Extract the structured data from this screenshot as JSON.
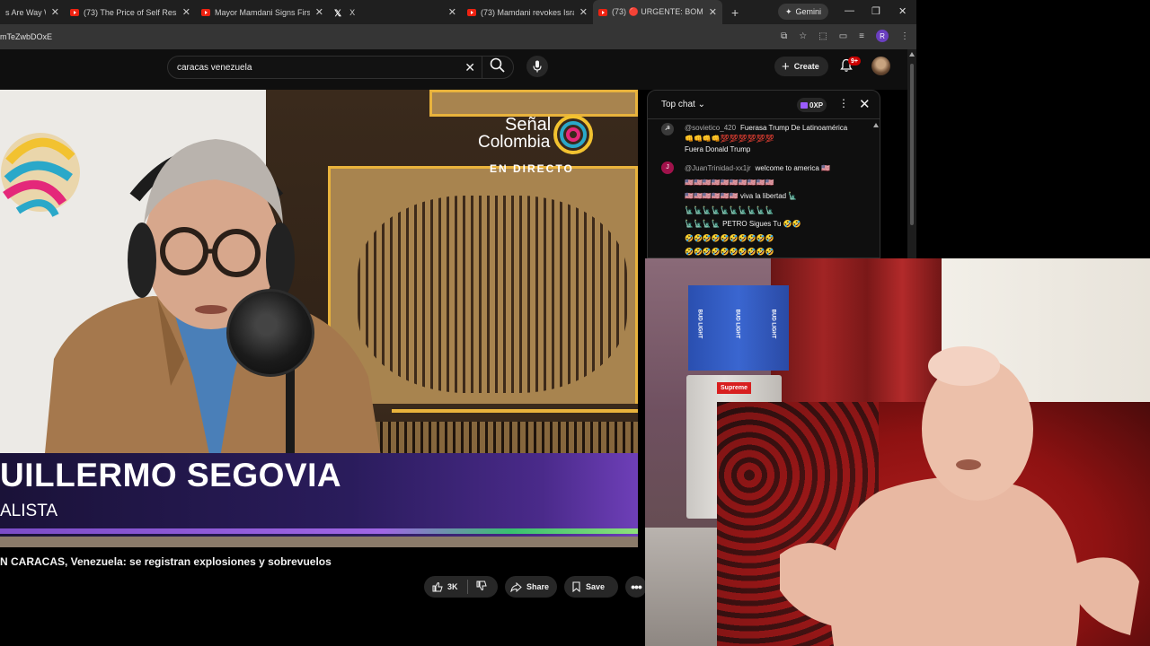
{
  "browser": {
    "tabs": [
      {
        "title": "s Are Way Wo",
        "favicon": "youtube-icon",
        "active": false
      },
      {
        "title": "(73) The Price of Self Respec",
        "favicon": "youtube-icon",
        "active": false
      },
      {
        "title": "Mayor Mamdani Signs First T",
        "favicon": "youtube-icon",
        "active": false
      },
      {
        "title": "X",
        "favicon": "x-icon",
        "active": false
      },
      {
        "title": "(73) Mamdani revokes Israel-",
        "favicon": "youtube-icon",
        "active": false
      },
      {
        "title": "(73) 🔴 URGENTE: BOMBA",
        "favicon": "youtube-icon",
        "active": true
      }
    ],
    "new_tab": "+",
    "gemini_label": "Gemini",
    "url": "mTeZwbDOxE",
    "profile_initial": "R"
  },
  "youtube": {
    "search_query": "caracas venezuela",
    "create_label": "Create",
    "notification_count": "9+"
  },
  "video": {
    "channel_brand_line1": "Señal",
    "channel_brand_line2": "Colombia",
    "live_label": "EN DIRECTO",
    "lower_third_name": "UILLERMO SEGOVIA",
    "lower_third_role": "ALISTA",
    "title": "N CARACAS, Venezuela: se registran explosiones y sobrevuelos",
    "like_count": "3K",
    "share_label": "Share",
    "save_label": "Save"
  },
  "chat": {
    "mode_label": "Top chat",
    "xp_label": "0XP",
    "messages": [
      {
        "user": "@sovietico_420",
        "text": "Fuerasa Trump De Latinoamérica",
        "line2": "👊👊👊👊💯💯💯💯💯💯",
        "line3": "Fuera Donald Trump",
        "avatar_initial": "",
        "avatar_color": "#3a3a3a"
      },
      {
        "user": "@JuanTrinidad-xx1jr",
        "text": "welcome to america 🇺🇸",
        "line2": "🇺🇸🇺🇸🇺🇸🇺🇸🇺🇸🇺🇸🇺🇸🇺🇸🇺🇸🇺🇸",
        "line3": "🇺🇸🇺🇸🇺🇸🇺🇸🇺🇸🇺🇸 viva la libertad 🗽",
        "line4": "🗽🗽🗽🗽🗽🗽🗽🗽🗽🗽",
        "line5": "🗽🗽🗽🗽 PETRO Sigues Tu 🤣🤣",
        "line6": "🤣🤣🤣🤣🤣🤣🤣🤣🤣🤣",
        "line7": "🤣🤣🤣🤣🤣🤣🤣🤣🤣🤣",
        "avatar_initial": "J",
        "avatar_color": "#a0124b"
      }
    ]
  },
  "webcam": {
    "sticker_text": "Supreme",
    "box_label": "BUD LIGHT"
  }
}
